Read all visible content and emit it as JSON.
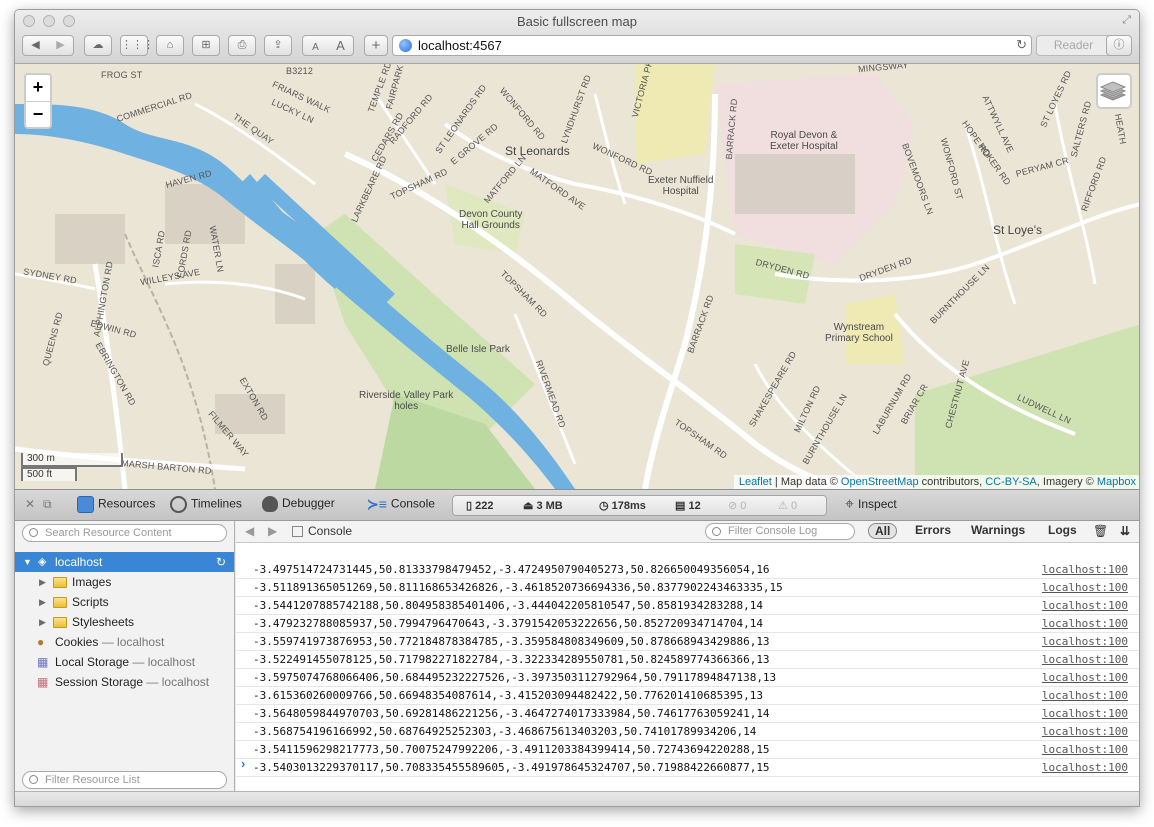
{
  "window": {
    "title": "Basic fullscreen map",
    "url": "localhost:4567",
    "reader_label": "Reader",
    "font_small": "A",
    "font_large": "A",
    "add_label": "+"
  },
  "map": {
    "zoom_in": "+",
    "zoom_out": "−",
    "scale_metric": "300 m",
    "scale_imperial": "500 ft",
    "attribution": {
      "leaflet": "Leaflet",
      "sep1": " | Map data © ",
      "osm": "OpenStreetMap",
      "sep2": " contributors, ",
      "license": "CC-BY-SA",
      "sep3": ", Imagery © ",
      "mapbox": "Mapbox"
    },
    "places": [
      "St Leonards",
      "St Loye's"
    ],
    "pois": [
      "Royal Devon &",
      "Exeter Hospital",
      "Exeter Nuffield",
      "Hospital",
      "Devon County",
      "Hall Grounds",
      "Belle Isle Park",
      "Riverside Valley Park",
      "holes",
      "Wynstream",
      "Primary School"
    ],
    "roads": [
      "FROG ST",
      "B3212",
      "COMMERCIAL RD",
      "FRIARS WALK",
      "LUCKY LN",
      "TEMPLE RD",
      "FAIRPARK",
      "RADFORD RD",
      "CEDARS RD",
      "ST LEONARDS RD",
      "E GROVE RD",
      "WONFORD RD",
      "LYNDHURST RD",
      "VICTORIA PK",
      "BARRACK RD",
      "THE QUAY",
      "HAVEN RD",
      "TOPSHAM RD",
      "LARKBEARE RD",
      "MATFORD LN",
      "MATFORD AVE",
      "WONFORD RD",
      "SYDNEY RD",
      "ALPHINGTON RD",
      "ISCA RD",
      "FORDS RD",
      "WATER LN",
      "WILLEYS AVE",
      "EDWIN RD",
      "QUEENS RD",
      "EBRINGTON RD",
      "EXTON RD",
      "FILMER WAY",
      "MARSH BARTON RD",
      "RIVERMEAD RD",
      "TOPSHAM RD",
      "TOPSHAM RD",
      "BARRACK RD",
      "DRYDEN RD",
      "DRYDEN RD",
      "SHAKESPEARE RD",
      "MILTON RD",
      "BURNTHOUSE LN",
      "LABURNUM RD",
      "BRIAR CR",
      "CHESTNUT AVE",
      "BURNTHOUSE LN",
      "LUDWELL LN",
      "BOVEMOORS LN",
      "WONFORD ST",
      "HOPE RD",
      "HOKER RD",
      "ATTWYLL AVE",
      "PERYAM CR",
      "ST LOYES RD",
      "SALTERS RD",
      "RIFFORD RD",
      "MINGSWAY",
      "HEATH"
    ]
  },
  "inspector": {
    "tabs": {
      "resources": "Resources",
      "timelines": "Timelines",
      "debugger": "Debugger",
      "console": "Console",
      "inspect": "Inspect"
    },
    "dashboard": {
      "resources_count": "222",
      "size": "3 MB",
      "load_time": "178ms",
      "logs": "12",
      "errors": "0",
      "warnings": "0"
    }
  },
  "sidebar": {
    "search_placeholder": "Search Resource Content",
    "filter_placeholder": "Filter Resource List",
    "root": "localhost",
    "folders": [
      "Images",
      "Scripts",
      "Stylesheets"
    ],
    "storage": [
      {
        "name": "Cookies",
        "suffix": " — localhost"
      },
      {
        "name": "Local Storage",
        "suffix": " — localhost"
      },
      {
        "name": "Session Storage",
        "suffix": " — localhost"
      }
    ]
  },
  "console": {
    "title": "Console",
    "filter_placeholder": "Filter Console Log",
    "filters": [
      "All",
      "Errors",
      "Warnings",
      "Logs"
    ],
    "rows": [
      {
        "text": "-3.497514724731445,50.81333798479452,-3.4724950790405273,50.826650049356054,16",
        "source": "localhost:100"
      },
      {
        "text": "-3.511891365051269,50.811168653426826,-3.4618520736694336,50.8377902243463335,15",
        "source": "localhost:100"
      },
      {
        "text": "-3.5441207885742188,50.804958385401406,-3.444042205810547,50.8581934283288,14",
        "source": "localhost:100"
      },
      {
        "text": "-3.479232788085937,50.7994796470643,-3.3791542053222656,50.852720934714704,14",
        "source": "localhost:100"
      },
      {
        "text": "-3.559741973876953,50.772184878384785,-3.359584808349609,50.878668943429886,13",
        "source": "localhost:100"
      },
      {
        "text": "-3.522491455078125,50.717982271822784,-3.322334289550781,50.824589774366366,13",
        "source": "localhost:100"
      },
      {
        "text": "-3.5975074768066406,50.684495232227526,-3.3973503112792964,50.79117894847138,13",
        "source": "localhost:100"
      },
      {
        "text": "-3.615360260009766,50.66948354087614,-3.415203094482422,50.776201410685395,13",
        "source": "localhost:100"
      },
      {
        "text": "-3.5648059844970703,50.69281486221256,-3.4647274017333984,50.74617763059241,14",
        "source": "localhost:100"
      },
      {
        "text": "-3.568754196166992,50.68764925252303,-3.468675613403203,50.74101789934206,14",
        "source": "localhost:100"
      },
      {
        "text": "-3.5411596298217773,50.70075247992206,-3.4911203384399414,50.72743694220288,15",
        "source": "localhost:100"
      },
      {
        "text": "-3.5403013229370117,50.708335455589605,-3.491978645324707,50.71988422660877,15",
        "source": "localhost:100"
      }
    ],
    "prompt": "›"
  }
}
